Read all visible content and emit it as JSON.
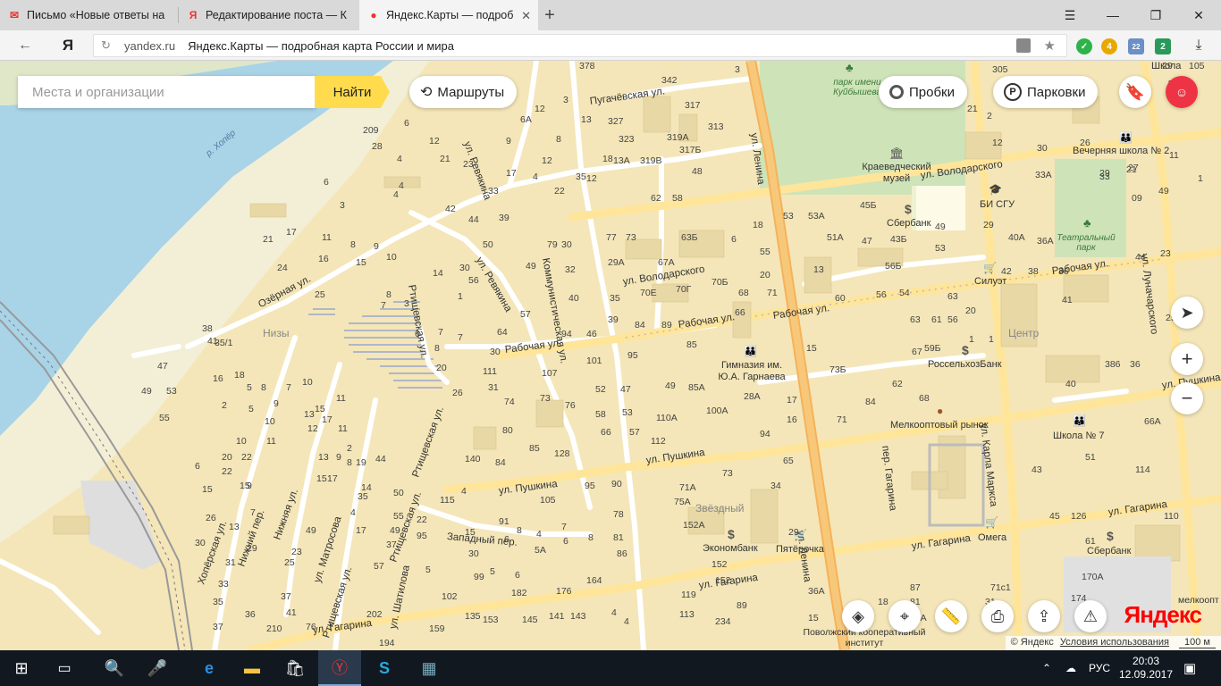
{
  "browser": {
    "tabs": [
      {
        "title": "Письмо «Новые ответы на",
        "icon": "mail-icon"
      },
      {
        "title": "Редактирование поста — К",
        "icon": "yandex-icon"
      },
      {
        "title": "Яндекс.Карты — подроб",
        "icon": "map-pin-icon"
      }
    ],
    "new_tab": "+",
    "address": {
      "domain": "yandex.ru",
      "title": "Яндекс.Карты — подробная карта России и мира"
    },
    "yandex_letter": "Я",
    "ext_badges": {
      "b1": "4",
      "b2": "22",
      "b3": "2"
    }
  },
  "map": {
    "search": {
      "placeholder": "Места и организации",
      "button": "Найти"
    },
    "routes": "Маршруты",
    "traffic": "Пробки",
    "parking": "Парковки",
    "logo": "Яндекс",
    "copyright": "© Яндекс",
    "terms": "Условия использования",
    "scale": "100 м",
    "streets": [
      {
        "text": "ул. Ленина",
        "k": "s1"
      },
      {
        "text": "ул. Ленина",
        "k": "s2"
      },
      {
        "text": "ул. Володарского",
        "k": "s3"
      },
      {
        "text": "ул. Володарского",
        "k": "s4"
      },
      {
        "text": "Рабочая ул.",
        "k": "s5"
      },
      {
        "text": "Рабочая ул.",
        "k": "s6"
      },
      {
        "text": "Рабочая ул.",
        "k": "s7"
      },
      {
        "text": "Рабочая ул.",
        "k": "s8"
      },
      {
        "text": "ул. Пушкина",
        "k": "s9"
      },
      {
        "text": "ул. Пушкина",
        "k": "s10"
      },
      {
        "text": "ул. Пушкина",
        "k": "s11"
      },
      {
        "text": "ул. Гагарина",
        "k": "s12"
      },
      {
        "text": "ул. Гагарина",
        "k": "s13"
      },
      {
        "text": "ул. Гагарина",
        "k": "s14"
      },
      {
        "text": "ул. Гагарина",
        "k": "s15"
      },
      {
        "text": "ул. Карла Маркса",
        "k": "s16"
      },
      {
        "text": "ул. Луначарского",
        "k": "s17"
      },
      {
        "text": "Коммунистическая ул.",
        "k": "s18"
      },
      {
        "text": "ул. Ревякина",
        "k": "s19"
      },
      {
        "text": "ул. Ревякина",
        "k": "s20"
      },
      {
        "text": "Пугачёвская ул.",
        "k": "s21"
      },
      {
        "text": "Озёрная ул.",
        "k": "s22"
      },
      {
        "text": "Ртищевская ул.",
        "k": "s23"
      },
      {
        "text": "Ртищевская ул.",
        "k": "s24"
      },
      {
        "text": "Ртищевская ул.",
        "k": "s25"
      },
      {
        "text": "Ртищевская ул.",
        "k": "s26"
      },
      {
        "text": "Хопёрская ул.",
        "k": "s27"
      },
      {
        "text": "Нижний пер.",
        "k": "s28"
      },
      {
        "text": "Нижняя ул.",
        "k": "s29"
      },
      {
        "text": "ул. Матросова",
        "k": "s30"
      },
      {
        "text": "ул. Шатилова",
        "k": "s31"
      },
      {
        "text": "Западный пер.",
        "k": "s32"
      },
      {
        "text": "пер. Гагарина",
        "k": "s33"
      },
      {
        "text": "р. Хопёр",
        "k": "s34"
      }
    ],
    "places": {
      "park": "парк имени Куйбышева",
      "museum": "Краеведческий музей",
      "sberbank1": "Сбербанк",
      "bisgu": "БИ СГУ",
      "theatre_park": "Театральный парк",
      "silhouette": "Силуэт",
      "center": "Центр",
      "gymnasium": "Гимназия им. Ю.А. Гарнаева",
      "rosselhoz": "РоссельхозБанк",
      "market": "Мелкооптовый рынок",
      "school7": "Школа № 7",
      "school2": "Вечерняя школа № 2",
      "school_top": "Школа",
      "zvezdny": "Звёздный",
      "ekonombank": "Экономбанк",
      "pyaterochka": "Пятёрочка",
      "omega": "Омега",
      "sberbank2": "Сбербанк",
      "institute": "Поволжский кооперативный институт",
      "nizy": "Низы",
      "melkoopt": "мелкоопт"
    }
  },
  "taskbar": {
    "lang": "РУС",
    "time": "20:03",
    "date": "12.09.2017"
  }
}
